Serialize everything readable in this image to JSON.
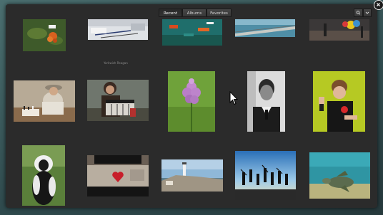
{
  "header": {
    "tabs": [
      {
        "label": "Recent",
        "active": true
      },
      {
        "label": "Albums",
        "active": false
      },
      {
        "label": "Favorites",
        "active": false
      }
    ],
    "search_icon": "search-icon",
    "menu_icon": "chevron-down-icon",
    "close_icon": "close-icon"
  },
  "photo_label": "Yorkwich Reagan",
  "photos": [
    {
      "subject": "orange-flower-plant"
    },
    {
      "subject": "desk-with-papers-and-pens"
    },
    {
      "subject": "boats-on-teal-water"
    },
    {
      "subject": "pier-over-water"
    },
    {
      "subject": "street-with-umbrellas"
    },
    {
      "subject": "man-playing-chess"
    },
    {
      "subject": "woman-with-accordion"
    },
    {
      "subject": "pink-orchid"
    },
    {
      "subject": "man-in-suit-portrait"
    },
    {
      "subject": "boy-with-apple"
    },
    {
      "subject": "colobus-monkey"
    },
    {
      "subject": "wall-with-red-heart"
    },
    {
      "subject": "lighthouse-coast"
    },
    {
      "subject": "jumping-silhouettes"
    },
    {
      "subject": "sea-turtle"
    }
  ],
  "colors": {
    "window_bg": "#2b2b2b",
    "header_bg": "#2b2b2b",
    "tab_text": "#d8d8d8"
  }
}
